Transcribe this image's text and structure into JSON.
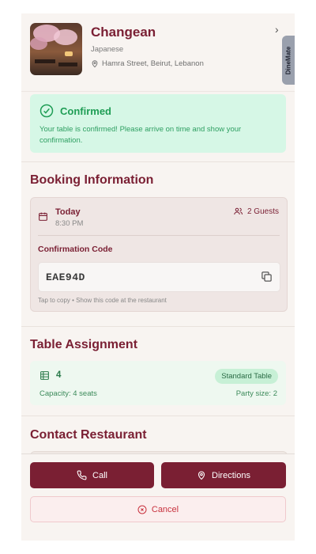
{
  "restaurant": {
    "name": "Changean",
    "cuisine": "Japanese",
    "address": "Hamra Street, Beirut, Lebanon"
  },
  "side_tab": "DineMate",
  "status": {
    "title": "Confirmed",
    "message": "Your table is confirmed! Please arrive on time and show your confirmation."
  },
  "booking": {
    "section_title": "Booking Information",
    "date": "Today",
    "time": "8:30 PM",
    "guests": "2 Guests",
    "code_label": "Confirmation Code",
    "code": "EAE94D",
    "hint": "Tap to copy • Show this code at the restaurant"
  },
  "table": {
    "section_title": "Table Assignment",
    "number": "4",
    "type": "Standard Table",
    "capacity": "Capacity: 4 seats",
    "party": "Party size: 2"
  },
  "contact": {
    "section_title": "Contact Restaurant"
  },
  "actions": {
    "call": "Call",
    "directions": "Directions",
    "cancel": "Cancel"
  },
  "colors": {
    "brand": "#7a1f33",
    "success": "#1f9d55",
    "success_bg": "#d6f7e6",
    "danger": "#c8323e"
  },
  "icons": [
    "chevron-right-icon",
    "map-pin-icon",
    "check-circle-icon",
    "calendar-icon",
    "users-icon",
    "copy-icon",
    "grid-icon",
    "phone-icon",
    "x-circle-icon"
  ]
}
